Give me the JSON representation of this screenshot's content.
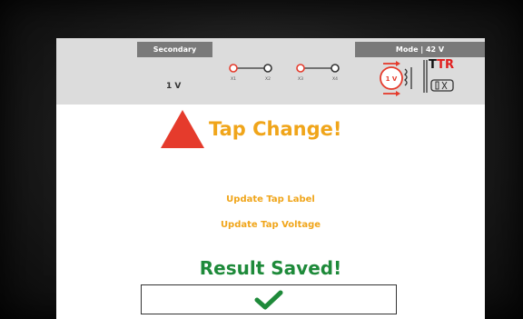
{
  "header": {
    "secondary_tab": "Secondary",
    "mode_tab": "Mode | 42 V",
    "voltage": "1 V",
    "terminal_labels": [
      "X1",
      "X2",
      "X3",
      "X4"
    ],
    "logo_text_black": "T",
    "logo_text_red": "TR",
    "hv_icon_text": "1 V"
  },
  "main": {
    "title": "Tap Change!",
    "update_tap_label": "Update Tap Label",
    "update_tap_voltage": "Update Tap Voltage",
    "status": "Result Saved!"
  },
  "colors": {
    "accent_orange": "#f0a51a",
    "warning_red": "#e53b2c",
    "success_green": "#1e8a3a",
    "tab_gray": "#7a7a7a",
    "header_bg": "#dcdcdc"
  },
  "icons": {
    "warning": "warning-triangle-icon",
    "confirm": "checkmark-icon",
    "transformer": "ttr-transformer-icon"
  }
}
